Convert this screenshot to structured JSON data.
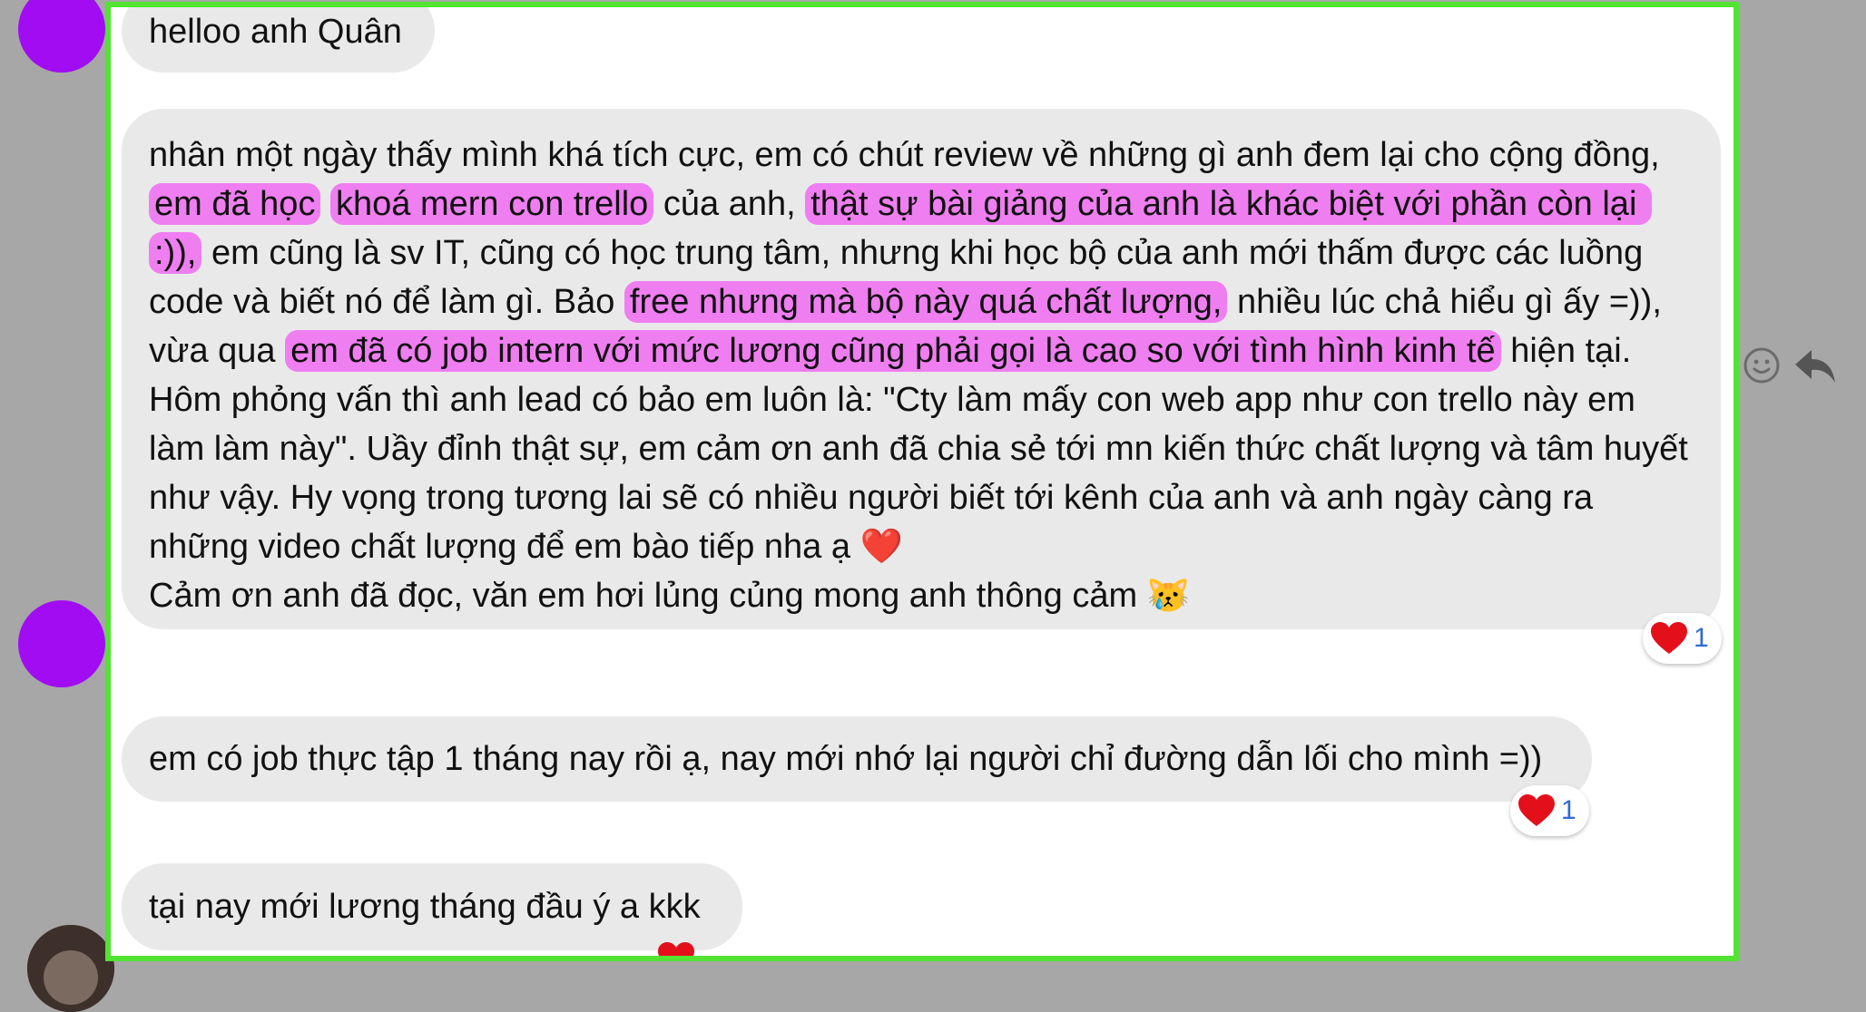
{
  "messages": [
    {
      "text": "helloo anh Quân"
    },
    {
      "segments": [
        {
          "t": "nhân một ngày thấy mình khá tích cực, em có chút review về những gì anh đem lại cho cộng đồng, ",
          "h": false
        },
        {
          "t": "em đã học",
          "h": true
        },
        {
          "t": " ",
          "h": false
        },
        {
          "t": "khoá mern con trello",
          "h": true
        },
        {
          "t": " của anh, ",
          "h": false
        },
        {
          "t": "thật sự bài giảng của anh là khác biệt với phần còn lại :)),",
          "h": true
        },
        {
          "t": " em cũng là sv IT, cũng có học trung tâm, nhưng khi học bộ của anh mới thấm được các luồng code và biết nó để làm gì. Bảo ",
          "h": false
        },
        {
          "t": "free nhưng mà bộ này quá chất lượng,",
          "h": true
        },
        {
          "t": " nhiều lúc chả hiểu gì ấy =)), vừa qua ",
          "h": false
        },
        {
          "t": "em đã có job intern với mức lương cũng phải gọi là cao so với tình hình kinh tế",
          "h": true
        },
        {
          "t": " hiện tại. Hôm phỏng vấn thì anh lead có bảo em luôn là: \"Cty làm mấy con web app như con trello này em làm làm này\". Uầy đỉnh thật sự, em cảm ơn anh đã chia sẻ tới mn kiến thức chất lượng và tâm huyết như vậy. Hy vọng trong tương lai sẽ có nhiều người biết tới kênh của anh và anh ngày càng ra những video chất lượng để em bào tiếp nha ạ ❤️",
          "h": false
        },
        {
          "t": "\nCảm ơn anh đã đọc, văn em hơi lủng củng mong anh thông cảm 😿",
          "h": false
        }
      ],
      "reaction": {
        "emoji": "heart",
        "count": "1"
      }
    },
    {
      "text": "em có job thực tập 1 tháng nay rồi ạ, nay mới nhớ lại người chỉ đường dẫn lối cho mình =))",
      "reaction": {
        "emoji": "heart",
        "count": "1"
      }
    },
    {
      "text": "tại nay mới lương tháng đầu ý a kkk"
    }
  ],
  "icons": {
    "react": "smiley-icon",
    "reply": "reply-arrow-icon"
  },
  "colors": {
    "highlight": "#ef7ef0",
    "frame": "#52e333",
    "avatar": "#a10cf2",
    "bubble": "#e9e9ea"
  }
}
